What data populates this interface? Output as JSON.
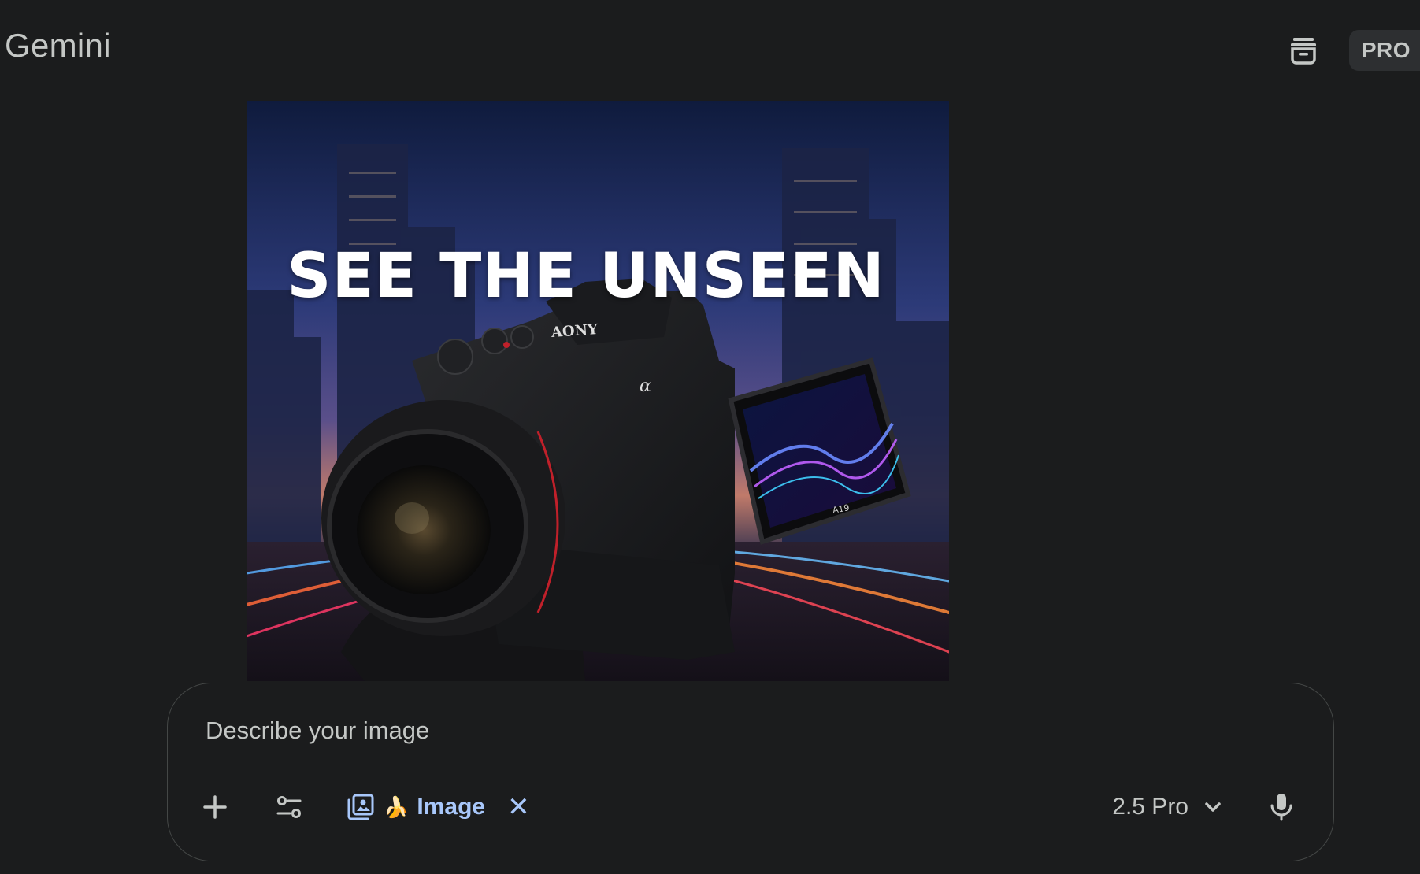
{
  "header": {
    "app_title": "Gemini",
    "temp_chat_icon": "temporary-chat-icon",
    "plan_badge": "PRO"
  },
  "generated_image": {
    "headline": "SEE THE UNSEEN",
    "brand": "AONY",
    "alpha": "α",
    "screen_label": "A19"
  },
  "prompt": {
    "placeholder": "Describe your image",
    "value": "",
    "add_icon": "plus-icon",
    "tools_icon": "tune-icon",
    "image_chip": {
      "icon": "image-gallery-icon",
      "emoji": "🍌",
      "label": "Image",
      "close": "✕"
    },
    "model": {
      "label": "2.5 Pro",
      "icon": "chevron-down-icon"
    },
    "mic_icon": "microphone-icon"
  },
  "colors": {
    "background": "#1b1c1d",
    "accent_blue": "#a8c7fa",
    "text_secondary": "#c4c7c5",
    "border": "#444746"
  }
}
